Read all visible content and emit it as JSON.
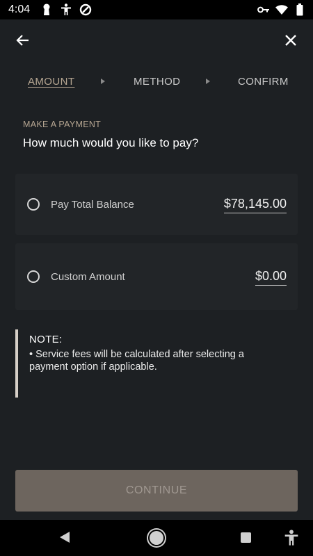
{
  "status_bar": {
    "time": "4:04",
    "left_icons": [
      "keyhole-icon",
      "accessibility-icon",
      "sync-icon"
    ],
    "right_icons": [
      "vpn-key-icon",
      "wifi-icon",
      "battery-icon"
    ]
  },
  "app_bar": {
    "back_icon": "arrow-left-icon",
    "close_icon": "close-icon"
  },
  "steps": [
    {
      "label": "AMOUNT",
      "active": true
    },
    {
      "label": "METHOD",
      "active": false
    },
    {
      "label": "CONFIRM",
      "active": false
    }
  ],
  "main": {
    "section_label": "MAKE A PAYMENT",
    "question": "How much would you like to pay?"
  },
  "options": [
    {
      "label": "Pay Total Balance",
      "amount": "$78,145.00",
      "selected": false
    },
    {
      "label": "Custom Amount",
      "amount": "$0.00",
      "selected": false
    }
  ],
  "note": {
    "title": "NOTE:",
    "text": "• Service fees will be calculated after selecting a payment option if applicable."
  },
  "continue_label": "CONTINUE",
  "nav_bar": {
    "icons": [
      "back-triangle-icon",
      "home-circle-icon",
      "recents-square-icon",
      "accessibility-icon"
    ]
  },
  "colors": {
    "background": "#1d2023",
    "accent": "#b6a692",
    "card": "#222528",
    "button": "#6d655e"
  }
}
